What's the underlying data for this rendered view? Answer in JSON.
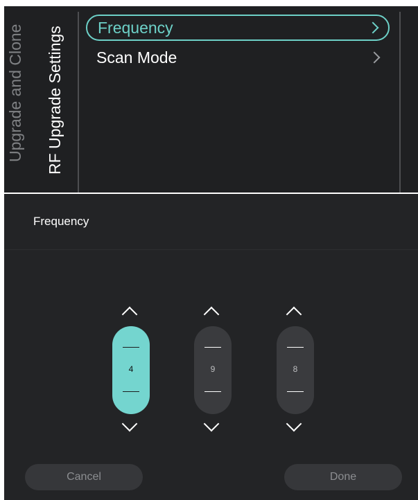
{
  "breadcrumb": {
    "parent": "Upgrade and Clone",
    "current": "RF Upgrade Settings"
  },
  "menu": {
    "items": [
      {
        "label": "Frequency",
        "selected": true,
        "icon": "chevron-right-icon"
      },
      {
        "label": "Scan Mode",
        "selected": false,
        "icon": "chevron-right-icon"
      }
    ]
  },
  "dialog": {
    "title": "Frequency",
    "digits": [
      {
        "value": "4",
        "active": true
      },
      {
        "value": "9",
        "active": false
      },
      {
        "value": "8",
        "active": false
      }
    ],
    "cancel_label": "Cancel",
    "done_label": "Done"
  },
  "colors": {
    "accent": "#6dd1c8",
    "active_pill": "#74d5cf",
    "background": "#1f2022",
    "dialog_background": "#232426"
  }
}
